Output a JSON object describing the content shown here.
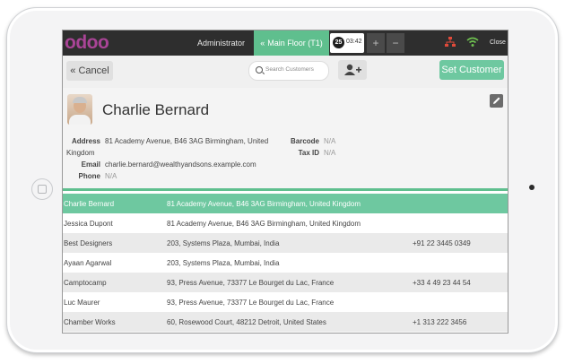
{
  "topbar": {
    "logo": "odoo",
    "user": "Administrator",
    "floor_label": "Main Floor (T1)",
    "order_badge": "25",
    "order_time": "03:42",
    "plus_label": "+",
    "minus_label": "−",
    "close_label": "Close"
  },
  "toolbar": {
    "cancel_label": "Cancel",
    "search_placeholder": "Search Customers",
    "set_customer_label": "Set Customer"
  },
  "customer": {
    "name": "Charlie Bernard",
    "address_label": "Address",
    "address_line1": "81 Academy Avenue, B46 3AG Birmingham, United",
    "address_line2": "Kingdom",
    "email_label": "Email",
    "email": "charlie.bernard@wealthyandsons.example.com",
    "phone_label": "Phone",
    "phone": "N/A",
    "barcode_label": "Barcode",
    "barcode": "N/A",
    "taxid_label": "Tax ID",
    "taxid": "N/A"
  },
  "customers": [
    {
      "name": "Charlie Bernard",
      "address": "81 Academy Avenue, B46 3AG Birmingham, United Kingdom",
      "phone": ""
    },
    {
      "name": "Jessica Dupont",
      "address": "81 Academy Avenue, B46 3AG Birmingham, United Kingdom",
      "phone": ""
    },
    {
      "name": "Best Designers",
      "address": "203, Systems Plaza, Mumbai, India",
      "phone": "+91 22 3445 0349"
    },
    {
      "name": "Ayaan Agarwal",
      "address": "203, Systems Plaza, Mumbai, India",
      "phone": ""
    },
    {
      "name": "Camptocamp",
      "address": "93, Press Avenue, 73377 Le Bourget du Lac, France",
      "phone": "+33 4 49 23 44 54"
    },
    {
      "name": "Luc Maurer",
      "address": "93, Press Avenue, 73377 Le Bourget du Lac, France",
      "phone": ""
    },
    {
      "name": "Chamber Works",
      "address": "60, Rosewood Court, 48212 Detroit, United States",
      "phone": "+1 313 222 3456"
    }
  ],
  "colors": {
    "brand": "#a94496",
    "accent_green": "#5fbf8e",
    "topbar": "#2e2e2e"
  }
}
